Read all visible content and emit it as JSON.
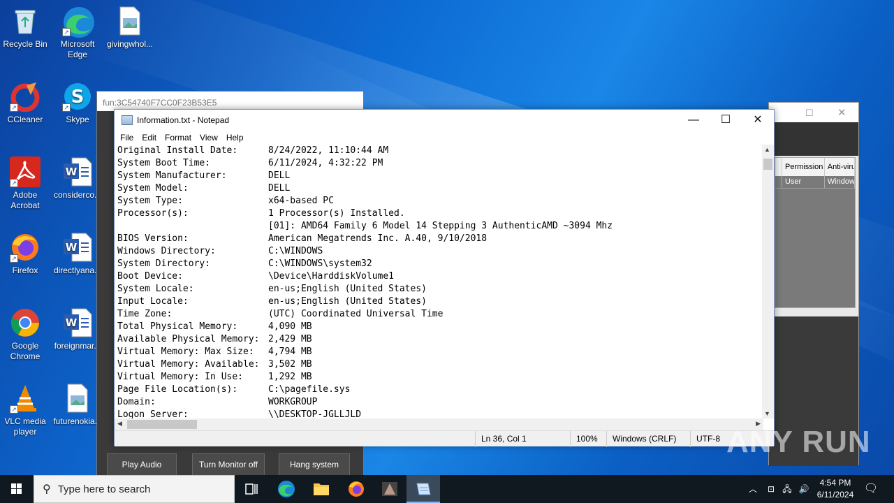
{
  "desktop_icons": [
    {
      "label": "Recycle Bin"
    },
    {
      "label": "Microsoft Edge"
    },
    {
      "label": "givingwhol..."
    },
    {
      "label": "CCleaner"
    },
    {
      "label": "Skype"
    },
    {
      "label": "Adobe Acrobat"
    },
    {
      "label": "considerco..."
    },
    {
      "label": "Firefox"
    },
    {
      "label": "directlyana..."
    },
    {
      "label": "Google Chrome"
    },
    {
      "label": "foreignmar..."
    },
    {
      "label": "VLC media player"
    },
    {
      "label": "futurenokia..."
    }
  ],
  "bg_app": {
    "title": "fun:3C54740F7CC0F23B53E5",
    "buttons": [
      "Play Audio",
      "Turn Monitor off",
      "Hang system"
    ]
  },
  "right_window": {
    "headers": [
      "Permission",
      "Anti-viru"
    ],
    "row1": [
      "User",
      "Window"
    ]
  },
  "notepad": {
    "title": "Information.txt - Notepad",
    "menu": [
      "File",
      "Edit",
      "Format",
      "View",
      "Help"
    ],
    "lines": [
      {
        "k": "Original Install Date:",
        "v": "8/24/2022, 11:10:44 AM"
      },
      {
        "k": "System Boot Time:",
        "v": "6/11/2024, 4:32:22 PM"
      },
      {
        "k": "System Manufacturer:",
        "v": "DELL"
      },
      {
        "k": "System Model:",
        "v": "DELL"
      },
      {
        "k": "System Type:",
        "v": "x64-based PC"
      },
      {
        "k": "Processor(s):",
        "v": "1 Processor(s) Installed."
      },
      {
        "k": "",
        "v": "[01]: AMD64 Family 6 Model 14 Stepping 3 AuthenticAMD ~3094 Mhz"
      },
      {
        "k": "BIOS Version:",
        "v": "American Megatrends Inc. A.40, 9/10/2018"
      },
      {
        "k": "Windows Directory:",
        "v": "C:\\WINDOWS"
      },
      {
        "k": "System Directory:",
        "v": "C:\\WINDOWS\\system32"
      },
      {
        "k": "Boot Device:",
        "v": "\\Device\\HarddiskVolume1"
      },
      {
        "k": "System Locale:",
        "v": "en-us;English (United States)"
      },
      {
        "k": "Input Locale:",
        "v": "en-us;English (United States)"
      },
      {
        "k": "Time Zone:",
        "v": "(UTC) Coordinated Universal Time"
      },
      {
        "k": "Total Physical Memory:",
        "v": "4,090 MB"
      },
      {
        "k": "Available Physical Memory:",
        "v": "2,429 MB"
      },
      {
        "k": "Virtual Memory: Max Size:",
        "v": "4,794 MB"
      },
      {
        "k": "Virtual Memory: Available:",
        "v": "3,502 MB"
      },
      {
        "k": "Virtual Memory: In Use:",
        "v": "1,292 MB"
      },
      {
        "k": "Page File Location(s):",
        "v": "C:\\pagefile.sys"
      },
      {
        "k": "Domain:",
        "v": "WORKGROUP"
      },
      {
        "k": "Logon Server:",
        "v": "\\\\DESKTOP-JGLLJLD"
      }
    ],
    "status": {
      "position": "Ln 36, Col 1",
      "zoom": "100%",
      "line_ending": "Windows (CRLF)",
      "encoding": "UTF-8"
    }
  },
  "taskbar": {
    "search_placeholder": "Type here to search",
    "time": "4:54 PM",
    "date": "6/11/2024"
  },
  "watermark": "ANY RUN"
}
